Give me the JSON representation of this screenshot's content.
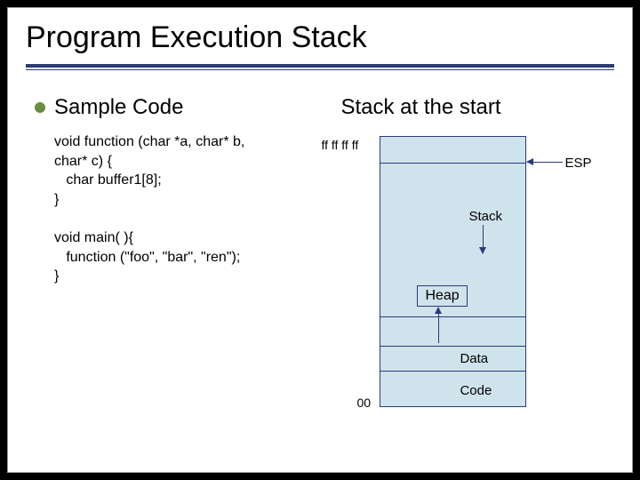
{
  "title": "Program Execution Stack",
  "left": {
    "bullet": "Sample Code",
    "code": "void function (char *a, char* b,\nchar* c) {\n   char buffer1[8];\n}\n\nvoid main( ){\n   function (\"foo\", \"bar\", \"ren\");\n}"
  },
  "right": {
    "heading": "Stack at the start",
    "addr_top": "ff ff ff ff",
    "addr_bot": "00",
    "esp": "ESP",
    "labels": {
      "stack": "Stack",
      "heap": "Heap",
      "data": "Data",
      "code": "Code"
    }
  }
}
